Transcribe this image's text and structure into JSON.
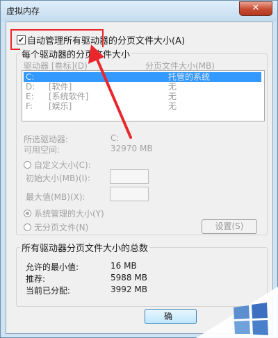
{
  "window": {
    "title": "虚拟内存",
    "close_glyph": "✕"
  },
  "auto_manage": {
    "label": "自动管理所有驱动器的分页文件大小(A)",
    "checked": true
  },
  "each_drive": {
    "group_title": "每个驱动器的分页文件大小",
    "col_drive": "驱动器 [卷标](D)",
    "col_size": "分页文件大小(MB)",
    "drives": [
      {
        "drive": "C:",
        "label": "",
        "size": "托管的系统",
        "selected": true
      },
      {
        "drive": "D:",
        "label": "[软件]",
        "size": "无",
        "selected": false
      },
      {
        "drive": "E:",
        "label": "[系统软件]",
        "size": "无",
        "selected": false
      },
      {
        "drive": "F:",
        "label": "[娱乐]",
        "size": "无",
        "selected": false
      }
    ],
    "selected_drive_label": "所选驱动器:",
    "selected_drive_value": "C:",
    "free_space_label": "可用空间:",
    "free_space_value": "32970 MB",
    "custom_size_label": "自定义大小(C):",
    "initial_size_label": "初始大小(MB)(I):",
    "max_size_label": "最大值(MB)(X):",
    "system_managed_label": "系统管理的大小(Y)",
    "no_paging_label": "无分页文件(N)",
    "selected_option": "system_managed",
    "set_button": "设置(S)"
  },
  "totals": {
    "group_title": "所有驱动器分页文件大小的总数",
    "min_label": "允许的最小值:",
    "min_value": "16 MB",
    "recommended_label": "推荐:",
    "recommended_value": "5988 MB",
    "current_label": "当前已分配:",
    "current_value": "3992 MB"
  },
  "ok_button": "确"
}
